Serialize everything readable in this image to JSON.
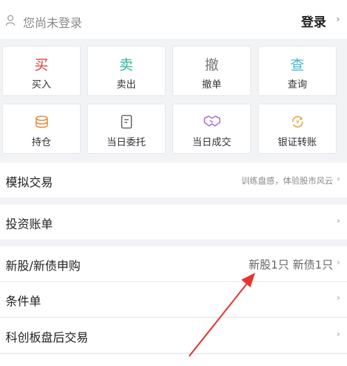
{
  "login": {
    "status_text": "您尚未登录",
    "login_label": "登录",
    "icon": "user-icon"
  },
  "grid": [
    {
      "label": "买入",
      "glyph": "买",
      "color": "#e0403a"
    },
    {
      "label": "卖出",
      "glyph": "卖",
      "color": "#2bb39a"
    },
    {
      "label": "撤单",
      "glyph": "撤",
      "color": "#777777"
    },
    {
      "label": "查询",
      "glyph": "查",
      "color": "#3fb8d6"
    },
    {
      "label": "持仓",
      "icon": "coins-icon",
      "color": "#e88a3a"
    },
    {
      "label": "当日委托",
      "icon": "document-icon",
      "color": "#666666"
    },
    {
      "label": "当日成交",
      "icon": "handshake-icon",
      "color": "#a66ad6"
    },
    {
      "label": "银证转账",
      "icon": "exchange-icon",
      "color": "#e6a23c"
    }
  ],
  "menu": [
    {
      "title": "模拟交易",
      "subtitle": "训练盘感，体验股市风云"
    },
    {
      "title": "投资账单",
      "subtitle": ""
    },
    {
      "title": "新股/新债申购",
      "subtitle": "新股1只 新债1只"
    },
    {
      "title": "条件单",
      "subtitle": ""
    },
    {
      "title": "科创板盘后交易",
      "subtitle": ""
    }
  ],
  "chevron": "›"
}
